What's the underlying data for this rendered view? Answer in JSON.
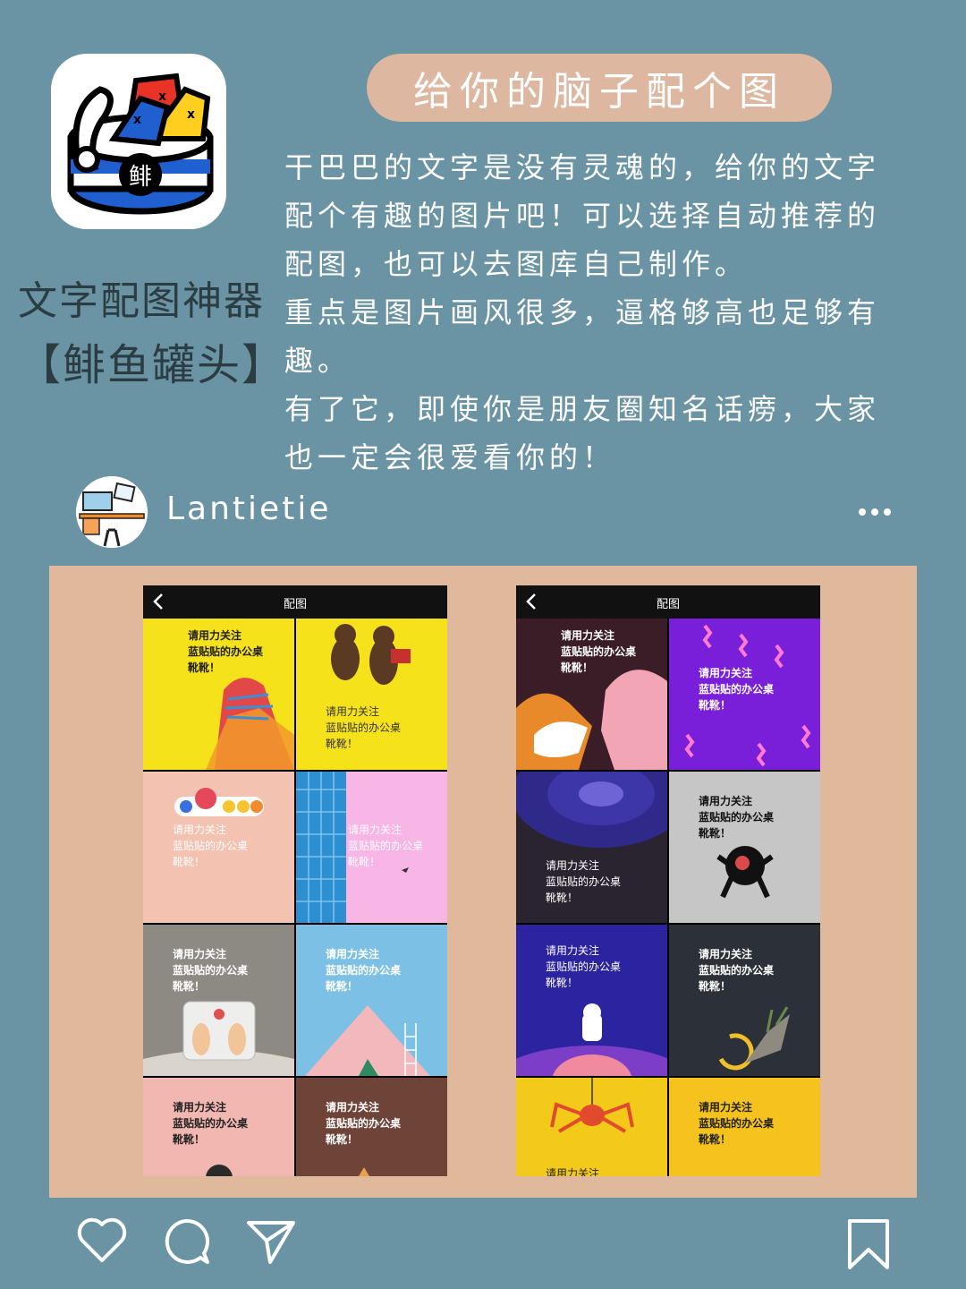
{
  "app": {
    "name_line1": "文字配图神器",
    "name_line2": "【鲱鱼罐头】",
    "icon_char": "鲱"
  },
  "title": "给你的脑子配个图",
  "description": [
    "干巴巴的文字是没有灵魂的，给你的文字配个有趣的图片吧！可以选择自动推荐的配图，也可以去图库自己制作。",
    "重点是图片画风很多，逼格够高也足够有趣。",
    "有了它，即使你是朋友圈知名话痨，大家也一定会很爱看你的！"
  ],
  "post": {
    "username": "Lantietie"
  },
  "screens": [
    {
      "title": "配图",
      "tiles": [
        {
          "bg": "#f6e21b",
          "text": "请用力关注\n蓝贴贴的办公桌\n靴靴！",
          "color": "#222"
        },
        {
          "bg": "#f6e21b",
          "text": "请用力关注\n蓝贴贴的办公桌\n靴靴！",
          "color": "#333"
        },
        {
          "bg": "#f3c2b0",
          "text": "请用力关注\n蓝贴贴的办公桌\n靴靴！",
          "color": "#fff"
        },
        {
          "bg": "#f7b6e6",
          "text": "请用力关注\n蓝贴贴的办公桌\n靴靴！",
          "color": "#fff"
        },
        {
          "bg": "#8c8a82",
          "text": "请用力关注\n蓝贴贴的办公桌\n靴靴！",
          "color": "#fff"
        },
        {
          "bg": "#7cc0e6",
          "text": "请用力关注\n蓝贴贴的办公桌\n靴靴！",
          "color": "#fff"
        },
        {
          "bg": "#f2b7b1",
          "text": "请用力关注\n蓝贴贴的办公桌\n靴靴！",
          "color": "#222"
        },
        {
          "bg": "#6e4338",
          "text": "请用力关注\n蓝贴贴的办公桌\n靴靴！",
          "color": "#fff"
        }
      ]
    },
    {
      "title": "配图",
      "tiles": [
        {
          "bg": "#3b1d28",
          "text": "请用力关注\n蓝贴贴的办公桌\n靴靴！",
          "color": "#fff"
        },
        {
          "bg": "#7a1fd9",
          "text": "请用力关注\n蓝贴贴的办公桌\n靴靴！",
          "color": "#fff"
        },
        {
          "bg": "#2a2430",
          "text": "请用力关注\n蓝贴贴的办公桌\n靴靴！",
          "color": "#fff"
        },
        {
          "bg": "#c6c6c6",
          "text": "请用力关注\n蓝贴贴的办公桌\n靴靴！",
          "color": "#111"
        },
        {
          "bg": "#2b23a0",
          "text": "请用力关注\n蓝贴贴的办公桌\n靴靴！",
          "color": "#fff"
        },
        {
          "bg": "#2c3038",
          "text": "请用力关注\n蓝贴贴的办公桌\n靴靴！",
          "color": "#fff"
        },
        {
          "bg": "#f3c91a",
          "text": "请用力关注",
          "color": "#222"
        },
        {
          "bg": "#f6c21e",
          "text": "请用力关注\n蓝贴贴的办公桌\n靴靴！",
          "color": "#222"
        }
      ]
    }
  ],
  "icons": {
    "like": "heart-icon",
    "comment": "comment-bubble-icon",
    "share": "send-arrow-icon",
    "save": "bookmark-icon",
    "more": "more-dots-icon"
  },
  "colors": {
    "background": "#6a93a3",
    "accent": "#ddb79f"
  }
}
